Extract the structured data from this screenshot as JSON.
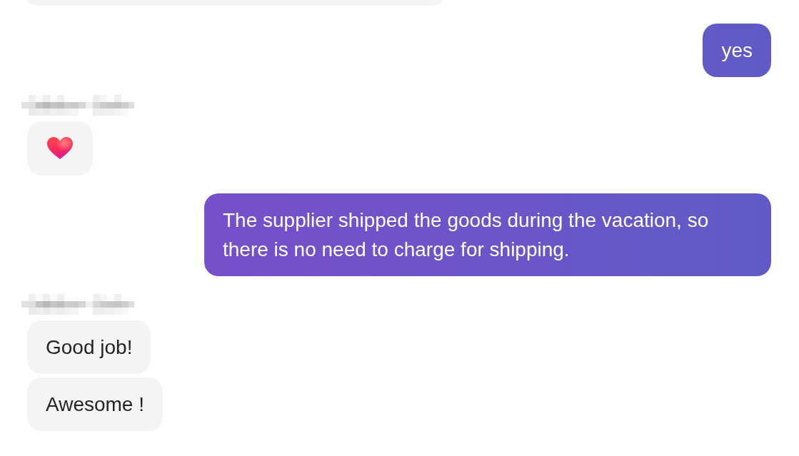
{
  "conversation": [
    {
      "kind": "incoming",
      "sender_blurred": false,
      "messages": [
        {
          "kind": "cut-off"
        }
      ]
    },
    {
      "kind": "outgoing",
      "sender_blurred": false,
      "messages": [
        {
          "kind": "text",
          "text": "yes"
        }
      ]
    },
    {
      "kind": "incoming",
      "sender_blurred": true,
      "messages": [
        {
          "kind": "heart"
        }
      ]
    },
    {
      "kind": "outgoing",
      "sender_blurred": false,
      "messages": [
        {
          "kind": "text",
          "text": "The supplier shipped the goods during the vacation, so there is no need to charge for shipping."
        }
      ]
    },
    {
      "kind": "incoming",
      "sender_blurred": true,
      "messages": [
        {
          "kind": "text",
          "text": "Good job!"
        },
        {
          "kind": "text",
          "text": "Awesome !"
        }
      ]
    }
  ]
}
